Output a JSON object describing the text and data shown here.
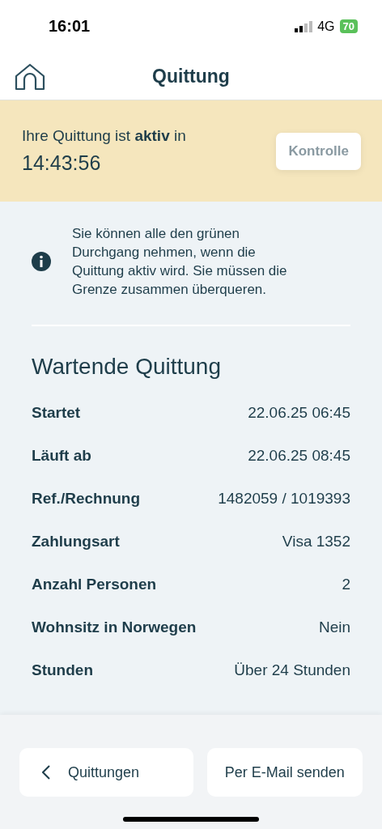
{
  "status_bar": {
    "time": "16:01",
    "network": "4G",
    "battery": "70"
  },
  "header": {
    "title": "Quittung"
  },
  "banner": {
    "text": "Ihre Quittung ist **aktiv** in",
    "countdown": "14:43:56",
    "button": {
      "label": "Kontrolle",
      "disabled": true
    }
  },
  "info": {
    "text": "Sie können alle den grünen Durchgang nehmen, wenn die Quittung aktiv wird. Sie müssen die Grenze zusammen überqueren."
  },
  "details": {
    "title": "Wartende Quittung",
    "rows": [
      {
        "label": "Startet",
        "value": "22.06.25 06:45"
      },
      {
        "label": "Läuft ab",
        "value": "22.06.25 08:45"
      },
      {
        "label": "Ref./Rechnung",
        "value": "1482059 / 1019393"
      },
      {
        "label": "Zahlungsart",
        "value": "Visa 1352"
      },
      {
        "label": "Anzahl Personen",
        "value": "2"
      },
      {
        "label": "Wohnsitz in Norwegen",
        "value": "Nein"
      },
      {
        "label": "Stunden",
        "value": "Über 24 Stunden"
      }
    ]
  },
  "footer": {
    "buttons": [
      {
        "label": "Quittungen",
        "kind": "back"
      },
      {
        "label": "Per E-Mail senden",
        "kind": "plain"
      }
    ]
  }
}
